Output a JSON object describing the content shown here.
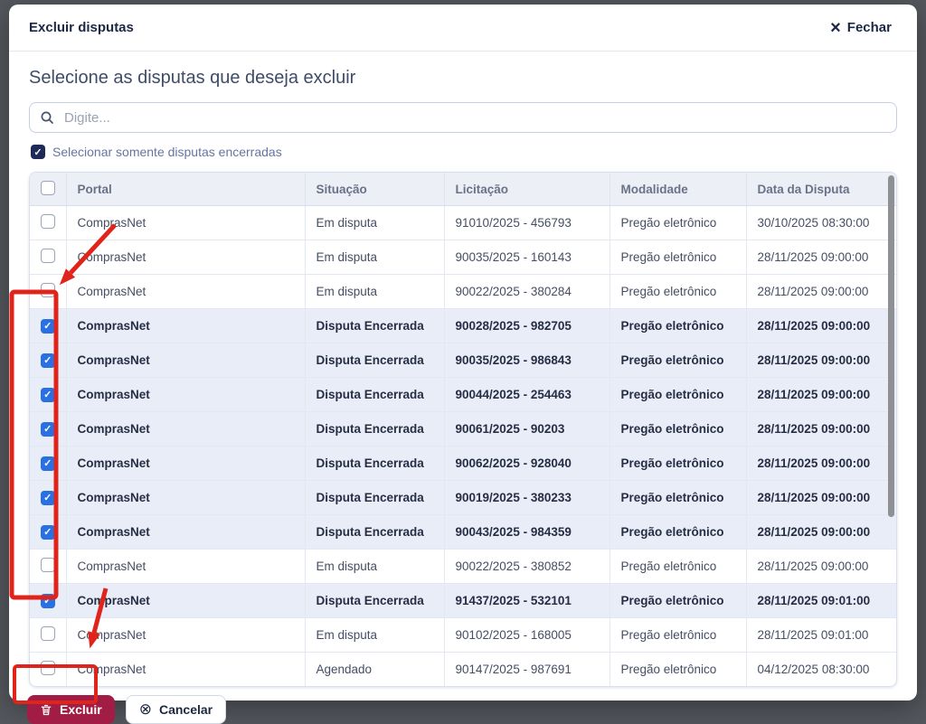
{
  "modal": {
    "title": "Excluir disputas",
    "close_label": "Fechar",
    "heading": "Selecione as disputas que deseja excluir",
    "search": {
      "placeholder": "Digite...",
      "value": ""
    },
    "filter_checkbox": {
      "label": "Selecionar somente disputas encerradas",
      "checked": true
    }
  },
  "table": {
    "columns": [
      "Portal",
      "Situação",
      "Licitação",
      "Modalidade",
      "Data da Disputa"
    ],
    "select_all_checked": false,
    "rows": [
      {
        "checked": false,
        "portal": "ComprasNet",
        "situacao": "Em disputa",
        "licitacao": "91010/2025 - 456793",
        "modalidade": "Pregão eletrônico",
        "data": "30/10/2025 08:30:00"
      },
      {
        "checked": false,
        "portal": "ComprasNet",
        "situacao": "Em disputa",
        "licitacao": "90035/2025 - 160143",
        "modalidade": "Pregão eletrônico",
        "data": "28/11/2025 09:00:00"
      },
      {
        "checked": false,
        "portal": "ComprasNet",
        "situacao": "Em disputa",
        "licitacao": "90022/2025 - 380284",
        "modalidade": "Pregão eletrônico",
        "data": "28/11/2025 09:00:00"
      },
      {
        "checked": true,
        "portal": "ComprasNet",
        "situacao": "Disputa Encerrada",
        "licitacao": "90028/2025 - 982705",
        "modalidade": "Pregão eletrônico",
        "data": "28/11/2025 09:00:00"
      },
      {
        "checked": true,
        "portal": "ComprasNet",
        "situacao": "Disputa Encerrada",
        "licitacao": "90035/2025 - 986843",
        "modalidade": "Pregão eletrônico",
        "data": "28/11/2025 09:00:00"
      },
      {
        "checked": true,
        "portal": "ComprasNet",
        "situacao": "Disputa Encerrada",
        "licitacao": "90044/2025 - 254463",
        "modalidade": "Pregão eletrônico",
        "data": "28/11/2025 09:00:00"
      },
      {
        "checked": true,
        "portal": "ComprasNet",
        "situacao": "Disputa Encerrada",
        "licitacao": "90061/2025 - 90203",
        "modalidade": "Pregão eletrônico",
        "data": "28/11/2025 09:00:00"
      },
      {
        "checked": true,
        "portal": "ComprasNet",
        "situacao": "Disputa Encerrada",
        "licitacao": "90062/2025 - 928040",
        "modalidade": "Pregão eletrônico",
        "data": "28/11/2025 09:00:00"
      },
      {
        "checked": true,
        "portal": "ComprasNet",
        "situacao": "Disputa Encerrada",
        "licitacao": "90019/2025 - 380233",
        "modalidade": "Pregão eletrônico",
        "data": "28/11/2025 09:00:00"
      },
      {
        "checked": true,
        "portal": "ComprasNet",
        "situacao": "Disputa Encerrada",
        "licitacao": "90043/2025 - 984359",
        "modalidade": "Pregão eletrônico",
        "data": "28/11/2025 09:00:00"
      },
      {
        "checked": false,
        "portal": "ComprasNet",
        "situacao": "Em disputa",
        "licitacao": "90022/2025 - 380852",
        "modalidade": "Pregão eletrônico",
        "data": "28/11/2025 09:00:00"
      },
      {
        "checked": true,
        "portal": "ComprasNet",
        "situacao": "Disputa Encerrada",
        "licitacao": "91437/2025 - 532101",
        "modalidade": "Pregão eletrônico",
        "data": "28/11/2025 09:01:00"
      },
      {
        "checked": false,
        "portal": "ComprasNet",
        "situacao": "Em disputa",
        "licitacao": "90102/2025 - 168005",
        "modalidade": "Pregão eletrônico",
        "data": "28/11/2025 09:01:00"
      },
      {
        "checked": false,
        "portal": "ComprasNet",
        "situacao": "Agendado",
        "licitacao": "90147/2025 - 987691",
        "modalidade": "Pregão eletrônico",
        "data": "04/12/2025 08:30:00"
      }
    ]
  },
  "footer": {
    "delete_label": "Excluir",
    "cancel_label": "Cancelar"
  },
  "icons": {
    "close": "×",
    "cancel_circle": "⊗",
    "check": "✓"
  },
  "colors": {
    "checkbox_blue": "#2970e3",
    "checkbox_navy": "#1d2a57",
    "delete_button_red": "#a11d45",
    "annotation_red": "#e0241b",
    "selected_row_bg": "#e9edf8",
    "header_bg": "#edeff7"
  }
}
